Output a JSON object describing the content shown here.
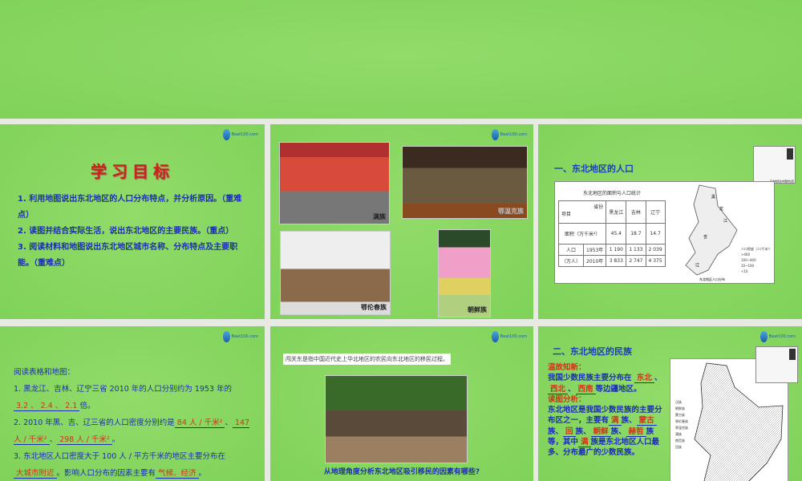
{
  "logo": {
    "text": "Beat100.com"
  },
  "slide1": {
    "title": "学习目标",
    "items": [
      "1. 利用地图说出东北地区的人口分布特点，并分析原因。（重难点）",
      "2. 读图并结合实际生活，说出东北地区的主要民族。（重点）",
      "3. 阅读材料和地图说出东北地区城市名称、分布特点及主要职能。（重难点）"
    ]
  },
  "slide2": {
    "captions": [
      "满族",
      "鄂温克族",
      "鄂伦春族",
      "朝鲜族"
    ]
  },
  "slide3": {
    "heading": "一、东北地区的人口",
    "table_title": "东北地区的面积与人口统计",
    "header": {
      "province": "省份",
      "item": "项目",
      "cols": [
        "黑龙江",
        "吉林",
        "辽宁"
      ]
    },
    "rows": [
      {
        "label": "面积（万千米²）",
        "values": [
          "45.4",
          "18.7",
          "14.7"
        ]
      },
      {
        "label": "人口",
        "year": "1953年",
        "values": [
          "1 190",
          "1 133",
          "2 039"
        ]
      },
      {
        "label": "（万人）",
        "year": "2010年",
        "values": [
          "3 833",
          "2 747",
          "4 375"
        ]
      }
    ],
    "map_caption": "东北地区人口分布",
    "map_labels": [
      "黑",
      "龙",
      "江",
      "吉",
      "辽"
    ],
    "legend_title": "人口密度（人/千米²）",
    "legend": [
      ">400",
      "100~400",
      "10~100",
      "<10"
    ],
    "inset_caption": "东北地区在中国的位置"
  },
  "slide4": {
    "intro": "阅读表格和地图：",
    "q1": "1. 黑龙江、吉林、辽宁三省 2010 年的人口分别约为 1953 年的",
    "a1": "3.2 、 2.4 、 2.1",
    "q1end": "倍。",
    "q2": "2. 2010 年黑、吉、辽三省的人口密度分别约是",
    "a2a": "84 人 / 千米²",
    "a2b": "147 人 / 千米²",
    "a2c": "298 人 / 千米²",
    "q3": "3. 东北地区人口密度大于 100 人 / 平方千米的地区主要分布在",
    "a3": "大城市附近",
    "q3b": "。影响人口分布的因素主要有",
    "a3b": "气候、经济",
    "end": "。"
  },
  "slide5": {
    "note": "闯关东是指中国近代史上华北地区的农民向东北地区的移民过程。",
    "question": "从地理角度分析东北地区吸引移民的因素有哪些?"
  },
  "slide6": {
    "heading": "二、东北地区的民族",
    "review": "温故知新：",
    "t1": "我国少数民族主要分布在",
    "b1": "东北",
    "b2": "西北",
    "b3": "西南",
    "t2": "等边疆地区。",
    "analysis": "读图分析：",
    "t3": "东北地区是我国少数民族的主要分布区之一，主要有",
    "e1": "满",
    "e2": "蒙古",
    "e3": "回",
    "e4": "朝鲜",
    "e5": "赫哲",
    "e6": "满",
    "t4": "族是东北地区人口最多、分布最广的少数民族。",
    "zu": "族",
    "t3b": "等，其中",
    "legend": [
      "汉族",
      "朝鲜族",
      "蒙古族",
      "鄂伦春族",
      "鄂温克族",
      "满族",
      "赫哲族",
      "回族"
    ]
  }
}
